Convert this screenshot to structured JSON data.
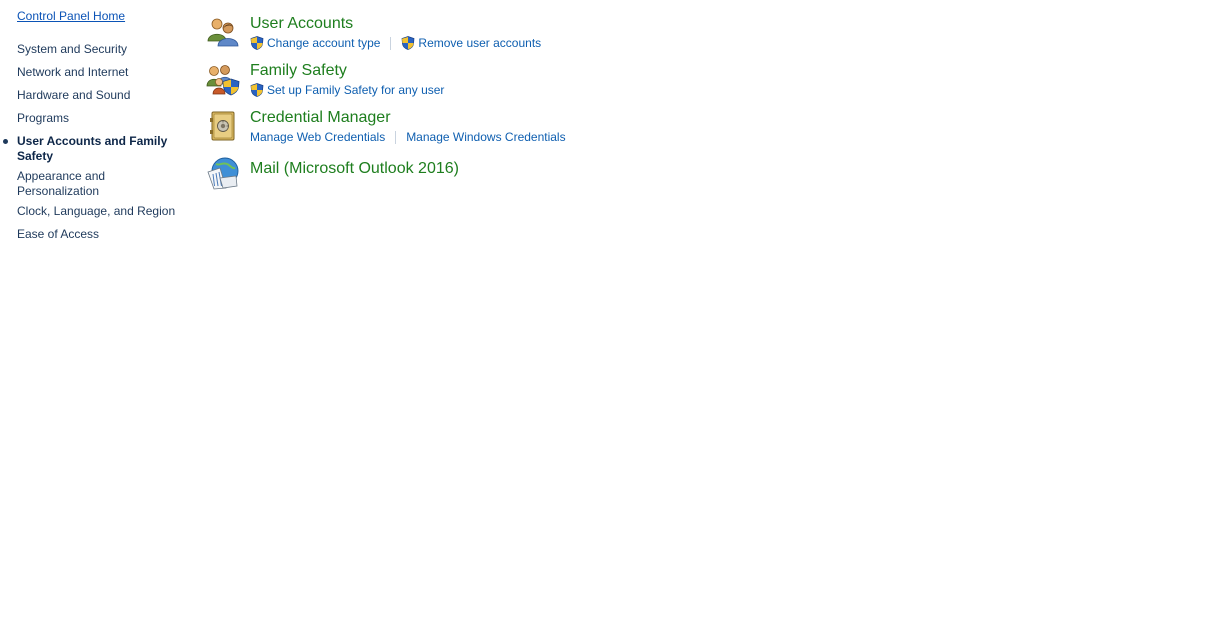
{
  "nav": {
    "home_label": "Control Panel Home",
    "items": [
      {
        "label": "System and Security"
      },
      {
        "label": "Network and Internet"
      },
      {
        "label": "Hardware and Sound"
      },
      {
        "label": "Programs"
      },
      {
        "label": "User Accounts and Family Safety"
      },
      {
        "label": "Appearance and Personalization"
      },
      {
        "label": "Clock, Language, and Region"
      },
      {
        "label": "Ease of Access"
      }
    ]
  },
  "categories": [
    {
      "title": "User Accounts",
      "icon": "users-icon",
      "tasks": [
        {
          "label": "Change account type",
          "shield": true
        },
        {
          "label": "Remove user accounts",
          "shield": true
        }
      ]
    },
    {
      "title": "Family Safety",
      "icon": "family-safety-icon",
      "tasks": [
        {
          "label": "Set up Family Safety for any user",
          "shield": true
        }
      ]
    },
    {
      "title": "Credential Manager",
      "icon": "credential-vault-icon",
      "tasks": [
        {
          "label": "Manage Web Credentials",
          "shield": false
        },
        {
          "label": "Manage Windows Credentials",
          "shield": false
        }
      ]
    },
    {
      "title": "Mail (Microsoft Outlook 2016)",
      "icon": "mail-icon",
      "tasks": []
    }
  ],
  "colors": {
    "category_title": "#1e7e1e",
    "task_link": "#0f5fb0",
    "nav_text": "#1e395b",
    "home_link": "#0b53b6"
  }
}
